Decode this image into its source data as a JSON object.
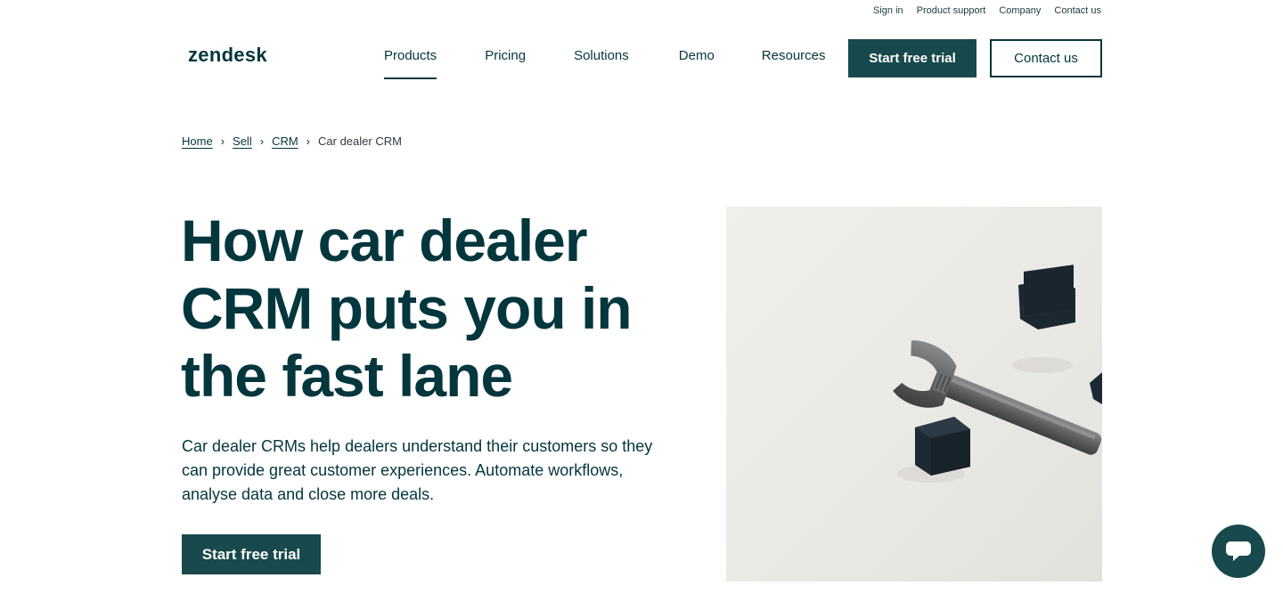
{
  "utility_nav": {
    "items": [
      "Sign in",
      "Product support",
      "Company",
      "Contact us"
    ]
  },
  "header": {
    "logo": "zendesk",
    "nav": [
      "Products",
      "Pricing",
      "Solutions",
      "Demo",
      "Resources"
    ],
    "active_nav": "Products",
    "primary_cta": "Start free trial",
    "secondary_cta": "Contact us"
  },
  "breadcrumb": {
    "items": [
      "Home",
      "Sell",
      "CRM"
    ],
    "current": "Car dealer CRM",
    "separator": "›"
  },
  "hero": {
    "title": "How car dealer CRM puts you in the fast lane",
    "description": "Car dealer CRMs help dealers understand their customers so they can provide great customer experiences. Automate workflows, analyse data and close more deals.",
    "cta": "Start free trial"
  },
  "colors": {
    "brand_dark": "#03363d",
    "button_bg": "#17494d",
    "image_bg": "#eceae6"
  },
  "icons": {
    "chat": "chat-bubble-icon"
  }
}
